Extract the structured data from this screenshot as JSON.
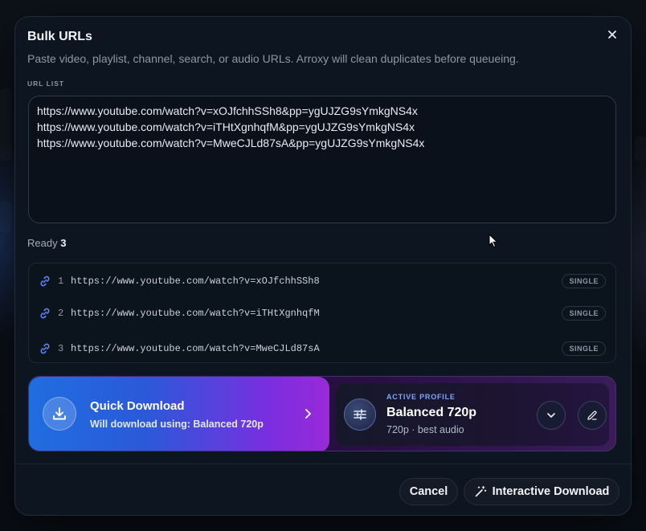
{
  "dialog": {
    "title": "Bulk URLs",
    "subtitle": "Paste video, playlist, channel, search, or audio URLs. Arroxy will clean duplicates before queueing.",
    "url_list_label": "URL LIST",
    "textarea_value": "https://www.youtube.com/watch?v=xOJfchhSSh8&pp=ygUJZG9sYmkgNS4x\nhttps://www.youtube.com/watch?v=iTHtXgnhqfM&pp=ygUJZG9sYmkgNS4x\nhttps://www.youtube.com/watch?v=MweCJLd87sA&pp=ygUJZG9sYmkgNS4x",
    "ready_label": "Ready",
    "ready_count": "3"
  },
  "parsed_urls": [
    {
      "index": "1",
      "url": "https://www.youtube.com/watch?v=xOJfchhSSh8",
      "badge": "SINGLE"
    },
    {
      "index": "2",
      "url": "https://www.youtube.com/watch?v=iTHtXgnhqfM",
      "badge": "SINGLE"
    },
    {
      "index": "3",
      "url": "https://www.youtube.com/watch?v=MweCJLd87sA",
      "badge": "SINGLE"
    }
  ],
  "quick_download": {
    "title": "Quick Download",
    "subtitle": "Will download using: Balanced 720p"
  },
  "profile": {
    "tag": "ACTIVE PROFILE",
    "name": "Balanced 720p",
    "description": "720p · best audio"
  },
  "footer": {
    "cancel_label": "Cancel",
    "interactive_label": "Interactive Download"
  },
  "colors": {
    "accent_blue": "#1f6ee0",
    "accent_purple": "#9a2ad8",
    "link_icon": "#5b8cff"
  },
  "icons": [
    "close-icon",
    "link-icon",
    "download-icon",
    "chevron-right-icon",
    "sliders-icon",
    "chevron-down-icon",
    "pencil-icon",
    "magic-wand-icon"
  ]
}
